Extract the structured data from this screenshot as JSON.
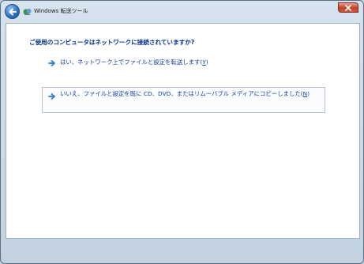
{
  "window": {
    "title": "Windows 転送ツール"
  },
  "titlebar": {
    "back_icon": "back-arrow-icon",
    "app_icon": "transfer-tool-icon",
    "close_icon": "close-icon"
  },
  "main": {
    "question": "ご使用のコンピュータはネットワークに接続されていますか?",
    "options": [
      {
        "label": "はい、ネットワーク上でファイルと設定を転送します(Y)",
        "text": "はい、ネットワーク上でファイルと設定を転送します(",
        "accesskey": "Y",
        "close": ")"
      },
      {
        "label": "いいえ、ファイルと設定を既に CD、DVD、またはリムーバブル メディアにコピーしました(N)",
        "text": "いいえ、ファイルと設定を既に CD、DVD、またはリムーバブル メディアにコピーしました(",
        "accesskey": "N",
        "close": ")"
      }
    ]
  },
  "colors": {
    "accent": "#1540a8",
    "heading": "#00318c",
    "arrow": "#2a7ad0"
  }
}
